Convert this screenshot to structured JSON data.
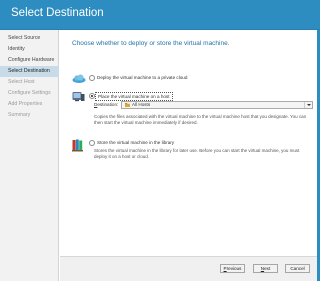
{
  "window": {
    "title": "Select Destination"
  },
  "sidebar": {
    "items": [
      {
        "label": "Select Source",
        "state": "done"
      },
      {
        "label": "Identity",
        "state": "done"
      },
      {
        "label": "Configure Hardware",
        "state": "done"
      },
      {
        "label": "Select Destination",
        "state": "current"
      },
      {
        "label": "Select Host",
        "state": "pending"
      },
      {
        "label": "Configure Settings",
        "state": "pending"
      },
      {
        "label": "Add Properties",
        "state": "pending"
      },
      {
        "label": "Summary",
        "state": "pending"
      }
    ]
  },
  "main": {
    "heading": "Choose whether to deploy or store the virtual machine.",
    "options": [
      {
        "label": "Deploy the virtual machine to a private cloud",
        "selected": false,
        "icon": "cloud-icon"
      },
      {
        "label": "Place the virtual machine on a host",
        "selected": true,
        "icon": "server-icon",
        "description_lines": [
          "Copies the files associated with the virtual machine to the virtual machine host that you designate. You can",
          "then start the virtual machine immediately if desired."
        ]
      },
      {
        "label": "Store the virtual machine in the library",
        "selected": false,
        "icon": "library-icon",
        "description_lines": [
          "Stores the virtual machine in the library for later use. Before you can start the virtual machine, you must",
          "deploy it on a host or cloud."
        ]
      }
    ],
    "destination": {
      "label_underlined": "D",
      "label_rest": "estination:",
      "value": "All Hosts",
      "icon": "hosts-folder-icon"
    }
  },
  "footer": {
    "previous": {
      "u": "P",
      "rest": "revious"
    },
    "next": {
      "u": "N",
      "rest": "ext"
    },
    "cancel": {
      "u": "",
      "rest": "Cancel"
    }
  },
  "colors": {
    "titlebar": "#2d8dc1",
    "accent_text": "#2673a6",
    "nav_selected": "#c7dbe9"
  }
}
